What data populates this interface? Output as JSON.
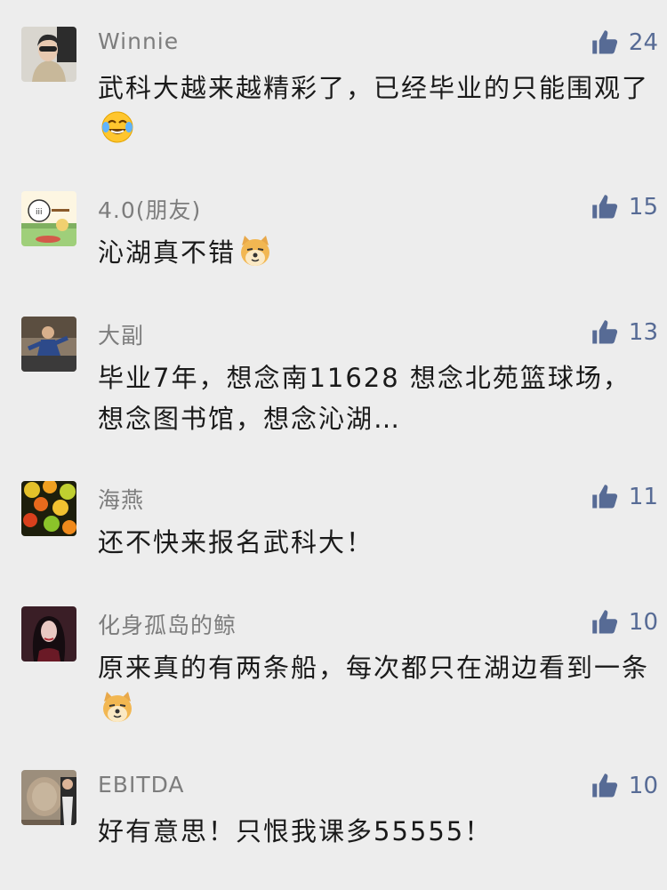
{
  "comments": [
    {
      "name": "Winnie",
      "likes": "24",
      "text": "武科大越来越精彩了，已经毕业的只能围观了",
      "emoji": "laughing-tears-emoji"
    },
    {
      "name": "4.0(朋友)",
      "likes": "15",
      "text": "沁湖真不错",
      "emoji": "doge-emoji"
    },
    {
      "name": "大副",
      "likes": "13",
      "text": "毕业7年，想念南11628 想念北苑篮球场，想念图书馆，想念沁湖…",
      "emoji": ""
    },
    {
      "name": "海燕",
      "likes": "11",
      "text": "还不快来报名武科大！",
      "emoji": ""
    },
    {
      "name": "化身孤岛的鲸",
      "likes": "10",
      "text": "原来真的有两条船，每次都只在湖边看到一条",
      "emoji": "doge-emoji"
    },
    {
      "name": "EBITDA",
      "likes": "10",
      "text": "好有意思！只恨我课多55555！",
      "emoji": ""
    }
  ],
  "icons": {
    "like": "thumbs-up-icon"
  },
  "colors": {
    "background": "#ededed",
    "name": "#7d7d7d",
    "count": "#576b95",
    "text": "#1a1a1a"
  }
}
